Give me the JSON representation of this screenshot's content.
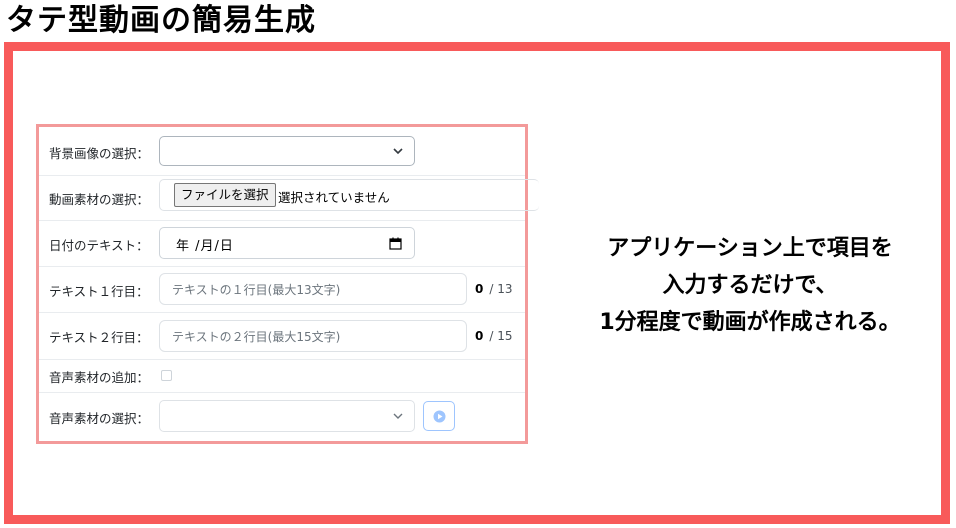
{
  "page": {
    "title": "タテ型動画の簡易生成"
  },
  "form": {
    "background_select": {
      "label": "背景画像の選択：",
      "value": ""
    },
    "video_file": {
      "label": "動画素材の選択：",
      "button_label": "ファイルを選択",
      "status": "選択されていません"
    },
    "date": {
      "label": "日付のテキスト：",
      "value": "年 /月/日"
    },
    "text_line1": {
      "label": "テキスト１行目：",
      "placeholder": "テキストの１行目(最大13文字)",
      "count": "0",
      "max": "/ 13"
    },
    "text_line2": {
      "label": "テキスト２行目：",
      "placeholder": "テキストの２行目(最大15文字)",
      "count": "0",
      "max": "/ 15"
    },
    "audio_add": {
      "label": "音声素材の追加：",
      "checked": false
    },
    "audio_select": {
      "label": "音声素材の選択：",
      "value": ""
    }
  },
  "caption": {
    "line1": "アプリケーション上で項目を",
    "line2": "入力するだけで、",
    "line3": "1分程度で動画が作成される。"
  },
  "colors": {
    "frame_border": "#f85a5a",
    "panel_border": "#f39a9a",
    "play_button": "#9ec5fe"
  },
  "icons": {
    "select_arrow": "chevron-down-icon",
    "date_picker": "calendar-icon",
    "play": "play-icon"
  }
}
